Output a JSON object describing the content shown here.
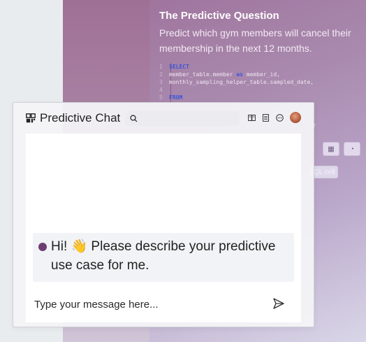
{
  "background": {
    "title": "The Predictive Question",
    "question": "Predict which gym members will cancel their membership in the next 12 months.",
    "code_lines": [
      {
        "n": "1",
        "text": "SELECT",
        "kw": true
      },
      {
        "n": "2",
        "text": "member_table.member ",
        "kw2": "as",
        "rest": " member_id,"
      },
      {
        "n": "3",
        "text": "monthly_sampling_helper_table.sampled_date,"
      },
      {
        "n": "4",
        "text": ""
      },
      {
        "n": "5",
        "text": "FROM",
        "kw": true
      }
    ],
    "truncated_text": "e",
    "sql_cell_label": "QL cell"
  },
  "chat": {
    "title": "Predictive Chat",
    "search_placeholder": "",
    "message": "Hi! 👋 Please describe your predictive use case for me.",
    "input_placeholder": "Type your message here..."
  },
  "icons": {
    "logo": "chat-logo-icon",
    "search": "search-icon",
    "book": "book-icon",
    "notes": "notes-icon",
    "more": "more-icon",
    "send": "send-icon",
    "grid": "grid-icon",
    "chart": "chart-icon"
  }
}
